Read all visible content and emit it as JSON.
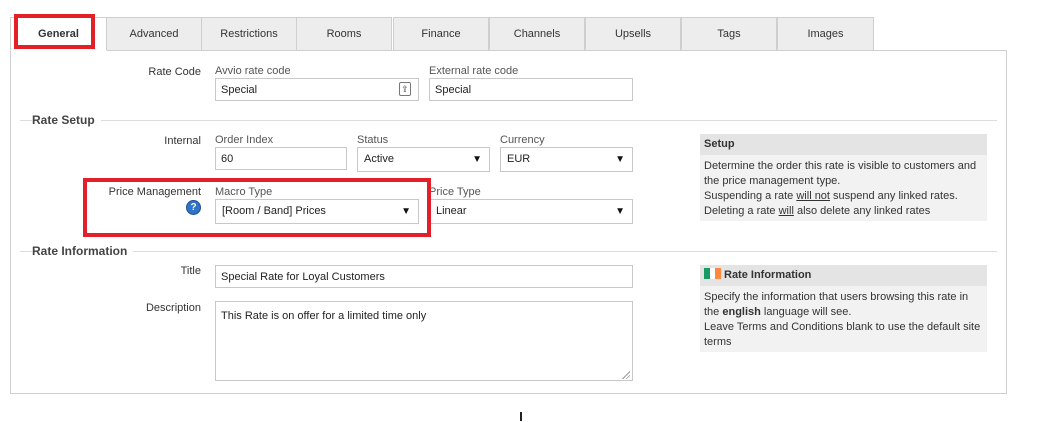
{
  "tabs": [
    {
      "label": "General",
      "active": true
    },
    {
      "label": "Advanced"
    },
    {
      "label": "Restrictions"
    },
    {
      "label": "Rooms"
    },
    {
      "label": "Finance"
    },
    {
      "label": "Channels"
    },
    {
      "label": "Upsells"
    },
    {
      "label": "Tags"
    },
    {
      "label": "Images"
    }
  ],
  "rate_code": {
    "label": "Rate Code",
    "avvio_label": "Avvio rate code",
    "avvio_value": "Special",
    "external_label": "External rate code",
    "external_value": "Special"
  },
  "rate_setup": {
    "title": "Rate Setup",
    "internal_label": "Internal",
    "order_index_label": "Order Index",
    "order_index_value": "60",
    "status_label": "Status",
    "status_value": "Active",
    "currency_label": "Currency",
    "currency_value": "EUR",
    "price_management_label": "Price Management",
    "macro_type_label": "Macro Type",
    "macro_type_value": "[Room / Band] Prices",
    "price_type_label": "Price Type",
    "price_type_value": "Linear"
  },
  "setup_info": {
    "title": "Setup",
    "line1": "Determine the order this rate is visible to customers and the price management type.",
    "line2_pre": "Suspending a rate ",
    "line2_u": "will not",
    "line2_post": " suspend any linked rates.",
    "line3_pre": "Deleting a rate ",
    "line3_u": "will",
    "line3_post": " also delete any linked rates"
  },
  "rate_information": {
    "title": "Rate Information",
    "title_label": "Title",
    "title_value": "Special Rate for Loyal Customers",
    "description_label": "Description",
    "description_value": "This Rate is on offer for a limited time only"
  },
  "rate_info_box": {
    "title": "Rate Information",
    "line1_pre": "Specify the information that users browsing this rate in the ",
    "line1_bold": "english",
    "line1_post": " language will see.",
    "line2": "Leave Terms and Conditions blank to use the default site terms"
  },
  "icons": {
    "help": "?",
    "select_arrow": "▼",
    "upload": "⇪"
  },
  "colors": {
    "highlight": "#e3202a",
    "help_icon": "#2f74c8",
    "flag_green": "#169b62",
    "flag_white": "#ffffff",
    "flag_orange": "#ff883e"
  }
}
